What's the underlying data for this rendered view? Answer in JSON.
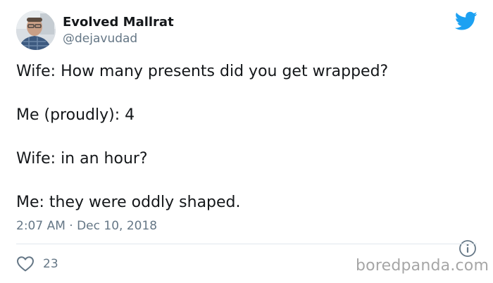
{
  "author": {
    "name": "Evolved Mallrat",
    "handle": "@dejavudad"
  },
  "tweet": {
    "lines": [
      "Wife: How many presents did you get wrapped?",
      "Me (proudly): 4",
      "Wife: in an hour?",
      "Me: they were oddly shaped."
    ],
    "timestamp": "2:07 AM · Dec 10, 2018"
  },
  "stats": {
    "likes": "23"
  },
  "watermark": "boredpanda.com",
  "icons": {
    "bird": "twitter-bird-icon",
    "info": "info-icon",
    "heart": "heart-icon"
  },
  "colors": {
    "brand": "#1da1f2",
    "text": "#14171a",
    "secondary": "#657786",
    "divider": "#e1e8ed",
    "watermark": "#a6a6a6"
  }
}
